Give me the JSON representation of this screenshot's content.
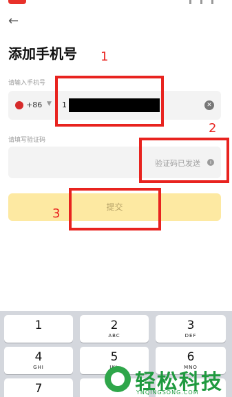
{
  "header": {
    "back_icon": "back-arrow-icon",
    "title": "添加手机号"
  },
  "phone": {
    "label": "请输入手机号",
    "country_code": "+86",
    "value_visible": "1",
    "clear_icon": "clear-icon"
  },
  "code": {
    "label": "请填写验证码",
    "sent_text": "验证码已发送",
    "info_icon": "info-icon"
  },
  "submit": {
    "label": "提交"
  },
  "annotations": [
    "1",
    "2",
    "3"
  ],
  "keyboard": {
    "keys": [
      {
        "num": "1",
        "letters": ""
      },
      {
        "num": "2",
        "letters": "ABC"
      },
      {
        "num": "3",
        "letters": "DEF"
      },
      {
        "num": "4",
        "letters": "GHI"
      },
      {
        "num": "5",
        "letters": "JKL"
      },
      {
        "num": "6",
        "letters": "MNO"
      },
      {
        "num": "7",
        "letters": ""
      }
    ]
  },
  "watermark": {
    "text": "轻松科技",
    "sub": "YNQINGSONG.COM"
  },
  "colors": {
    "annotation": "#e8231f",
    "submit_bg": "#fde9a2",
    "input_bg": "#f3f3f3",
    "keyboard_bg": "#d4d7dd",
    "watermark": "#1f9a3f"
  }
}
